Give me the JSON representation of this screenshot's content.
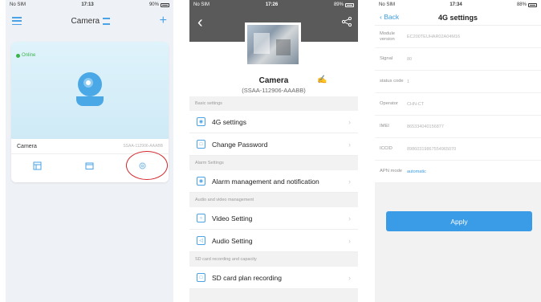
{
  "screen1": {
    "status": {
      "carrier": "No SIM",
      "time": "17:13",
      "battery": "90%"
    },
    "nav_title": "Camera",
    "online_label": "Online",
    "camera_name": "Camera",
    "camera_id": "SSAA-112906-AAABB"
  },
  "screen2": {
    "status": {
      "carrier": "No SIM",
      "time": "17:26",
      "battery": "89%"
    },
    "camera_name": "Camera",
    "camera_id": "(SSAA-112906-AAABB)",
    "sections": [
      {
        "title": "Basic settings",
        "items": [
          "4G settings",
          "Change Password"
        ]
      },
      {
        "title": "Alarm Settings",
        "items": [
          "Alarm management and notification"
        ]
      },
      {
        "title": "Audio and video management",
        "items": [
          "Video Setting",
          "Audio Setting"
        ]
      },
      {
        "title": "SD card recording and capacity",
        "items": [
          "SD card plan recording"
        ]
      }
    ]
  },
  "screen3": {
    "status": {
      "carrier": "No SIM",
      "time": "17:34",
      "battery": "88%"
    },
    "back_label": "Back",
    "title": "4G settings",
    "rows": [
      {
        "key": "Module version",
        "value": "EC200TEUHAR02A04M16"
      },
      {
        "key": "Signal",
        "value": "80"
      },
      {
        "key": "status code",
        "value": "1"
      },
      {
        "key": "Operator",
        "value": "CHN-CT"
      },
      {
        "key": "IMEI",
        "value": "865334040156877"
      },
      {
        "key": "ICCID",
        "value": "89860319867554965070"
      },
      {
        "key": "APN mode",
        "value": "automatic"
      }
    ],
    "apply_label": "Apply"
  },
  "colors": {
    "accent": "#3a9be6",
    "online": "#3cb44b",
    "highlight_ring": "#d3262b"
  },
  "icons": [
    "menu-icon",
    "list-icon",
    "plus-icon",
    "camera-icon",
    "playback-icon",
    "folder-icon",
    "gear-icon",
    "back-icon",
    "share-icon",
    "edit-icon",
    "chevron-right-icon"
  ]
}
